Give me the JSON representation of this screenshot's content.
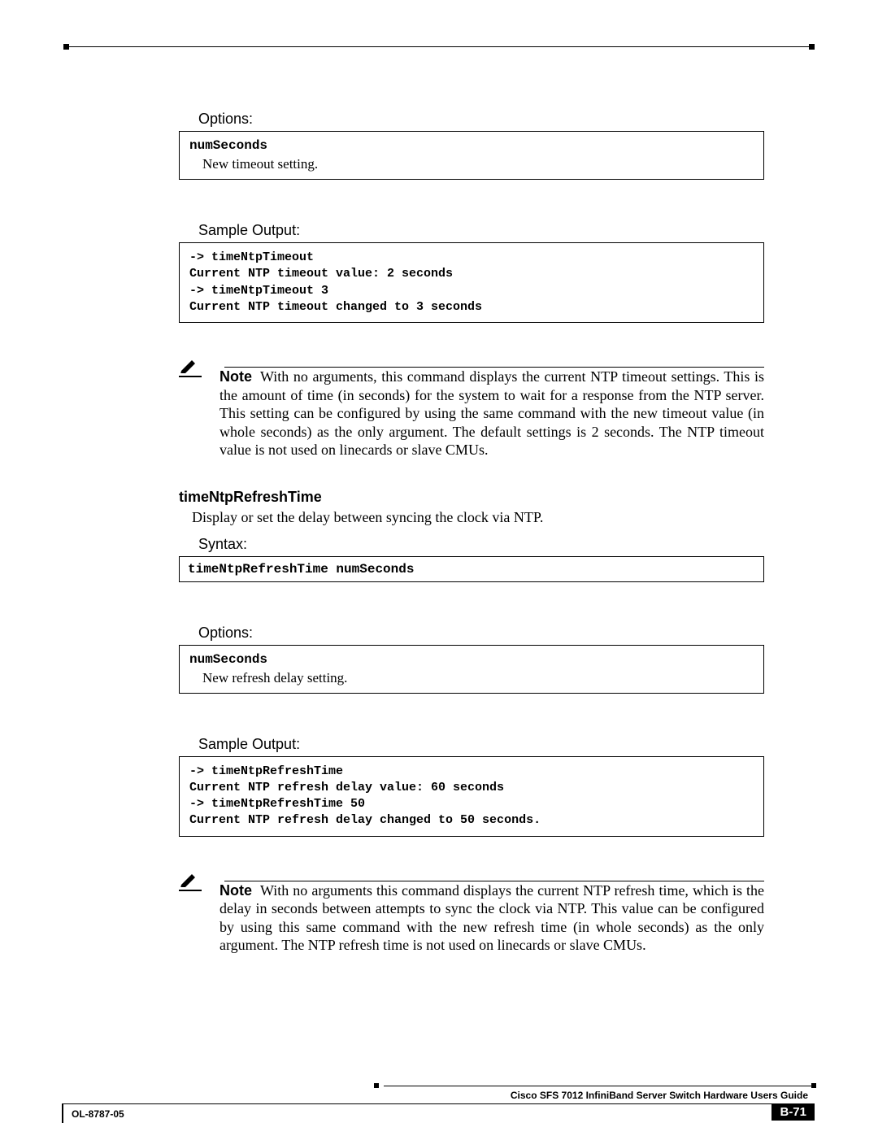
{
  "section1": {
    "options_label": "Options:",
    "option_name": "numSeconds",
    "option_desc": "New timeout setting.",
    "sample_label": "Sample Output:",
    "sample_code": "-> timeNtpTimeout\nCurrent NTP timeout value: 2 seconds\n-> timeNtpTimeout 3\nCurrent NTP timeout changed to 3 seconds",
    "note_label": "Note",
    "note_text": "With no arguments, this command displays the current NTP timeout settings.  This is the amount of time (in seconds) for the system to wait for a response from the NTP server.  This setting can be configured by using the same command with the new timeout value (in whole seconds) as the only argument.  The default settings is 2 seconds. The NTP timeout value is not used on linecards or slave CMUs."
  },
  "section2": {
    "heading": "timeNtpRefreshTime",
    "desc": "Display or set the delay between syncing the clock via NTP.",
    "syntax_label": "Syntax:",
    "syntax_code": "timeNtpRefreshTime numSeconds",
    "options_label": "Options:",
    "option_name": "numSeconds",
    "option_desc": "New refresh delay setting.",
    "sample_label": "Sample Output:",
    "sample_code": "-> timeNtpRefreshTime\nCurrent NTP refresh delay value: 60 seconds\n-> timeNtpRefreshTime 50\nCurrent NTP refresh delay changed to 50 seconds.",
    "note_label": "Note",
    "note_text": "With no arguments this command displays the current NTP refresh time, which is the delay in seconds between attempts to sync the clock via NTP. This value can be configured by using this same command with the new refresh time (in whole seconds) as the only argument.  The NTP refresh time is not used on linecards or slave CMUs."
  },
  "footer": {
    "book_title": "Cisco SFS 7012 InfiniBand Server Switch Hardware Users Guide",
    "doc_id": "OL-8787-05",
    "page_num": "B-71"
  }
}
